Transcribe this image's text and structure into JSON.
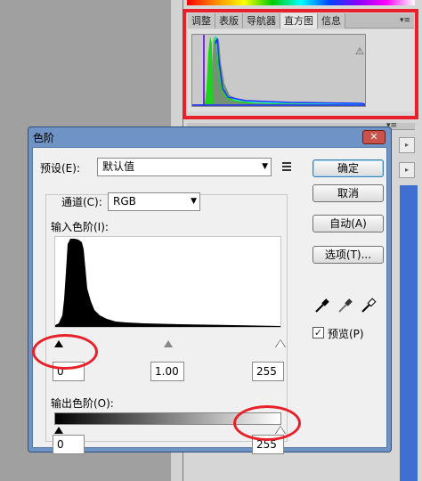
{
  "panel": {
    "tabs": [
      "调整",
      "表版",
      "导航器",
      "直方图",
      "信息"
    ],
    "active_tab": "直方图",
    "menu_glyph": "▾≡",
    "warning_glyph": "⚠"
  },
  "dialog": {
    "title": "色阶",
    "close_glyph": "✕",
    "preset_label": "预设(E):",
    "preset_value": "默认值",
    "channel_label": "通道(C):",
    "channel_value": "RGB",
    "input_levels_label": "输入色阶(I):",
    "input_black": "0",
    "input_gamma": "1.00",
    "input_white": "255",
    "output_levels_label": "输出色阶(O):",
    "output_black": "0",
    "output_white": "255",
    "buttons": {
      "ok": "确定",
      "cancel": "取消",
      "auto": "自动(A)",
      "options": "选项(T)..."
    },
    "preview_label": "预览(P)",
    "preview_checked": true,
    "check_glyph": "✓",
    "combo_arrow": "▼"
  },
  "colors": {
    "highlight": "#e8202a",
    "dialog_frame": "#6f93c4",
    "close_button": "#c9534a"
  }
}
